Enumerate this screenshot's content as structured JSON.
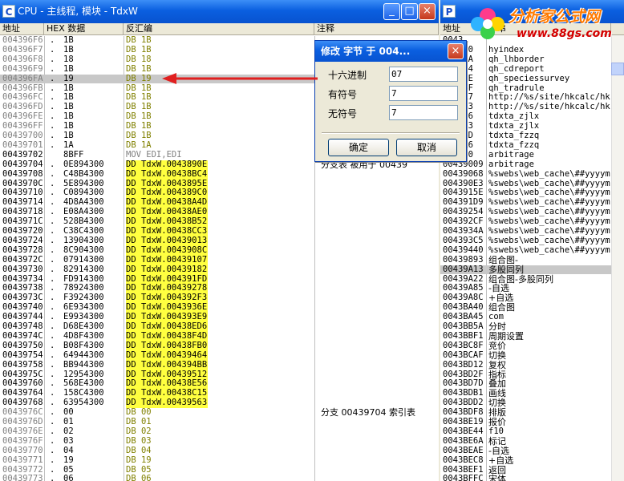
{
  "cpu_window": {
    "icon_letter": "C",
    "title": "CPU - 主线程, 模块 - TdxW",
    "buttons": [
      "_",
      "□",
      "×"
    ],
    "headers": [
      "地址",
      "HEX 数据",
      "反汇编",
      "注释"
    ],
    "rows": [
      {
        "addr": "004396F6",
        "dot": ".",
        "hex": "1B",
        "dis": "DB 1B",
        "style": "olive",
        "cmt": ""
      },
      {
        "addr": "004396F7",
        "dot": ".",
        "hex": "1B",
        "dis": "DB 1B",
        "style": "olive",
        "cmt": ""
      },
      {
        "addr": "004396F8",
        "dot": ".",
        "hex": "18",
        "dis": "DB 18",
        "style": "olive",
        "cmt": ""
      },
      {
        "addr": "004396F9",
        "dot": ".",
        "hex": "1B",
        "dis": "DB 1B",
        "style": "olive",
        "cmt": ""
      },
      {
        "addr": "004396FA",
        "dot": ".",
        "hex": "19",
        "dis": "DB 19",
        "style": "olive",
        "cmt": "",
        "selected": true
      },
      {
        "addr": "004396FB",
        "dot": ".",
        "hex": "1B",
        "dis": "DB 1B",
        "style": "olive",
        "cmt": ""
      },
      {
        "addr": "004396FC",
        "dot": ".",
        "hex": "1B",
        "dis": "DB 1B",
        "style": "olive",
        "cmt": ""
      },
      {
        "addr": "004396FD",
        "dot": ".",
        "hex": "1B",
        "dis": "DB 1B",
        "style": "olive",
        "cmt": ""
      },
      {
        "addr": "004396FE",
        "dot": ".",
        "hex": "1B",
        "dis": "DB 1B",
        "style": "olive",
        "cmt": ""
      },
      {
        "addr": "004396FF",
        "dot": ".",
        "hex": "1B",
        "dis": "DB 1B",
        "style": "olive",
        "cmt": ""
      },
      {
        "addr": "00439700",
        "dot": ".",
        "hex": "1B",
        "dis": "DB 1B",
        "style": "olive",
        "cmt": ""
      },
      {
        "addr": "00439701",
        "dot": ".",
        "hex": "1A",
        "dis": "DB 1A",
        "style": "olive",
        "cmt": ""
      },
      {
        "addr": "00439702",
        "dot": "",
        "hex": "8BFF",
        "dis": "MOV EDI,EDI",
        "style": "mov",
        "cmt": ""
      },
      {
        "addr": "00439704",
        "dot": ".",
        "hex": "0E894300",
        "dis": "DD TdxW.0043890E",
        "style": "dd",
        "cmt": "分支表 被用于 00439"
      },
      {
        "addr": "00439708",
        "dot": ".",
        "hex": "C48B4300",
        "dis": "DD TdxW.00438BC4",
        "style": "dd",
        "cmt": ""
      },
      {
        "addr": "0043970C",
        "dot": ".",
        "hex": "5E894300",
        "dis": "DD TdxW.0043895E",
        "style": "dd",
        "cmt": ""
      },
      {
        "addr": "00439710",
        "dot": ".",
        "hex": "C0894300",
        "dis": "DD TdxW.004389C0",
        "style": "dd",
        "cmt": ""
      },
      {
        "addr": "00439714",
        "dot": ".",
        "hex": "4D8A4300",
        "dis": "DD TdxW.00438A4D",
        "style": "dd",
        "cmt": ""
      },
      {
        "addr": "00439718",
        "dot": ".",
        "hex": "E08A4300",
        "dis": "DD TdxW.00438AE0",
        "style": "dd",
        "cmt": ""
      },
      {
        "addr": "0043971C",
        "dot": ".",
        "hex": "528B4300",
        "dis": "DD TdxW.00438B52",
        "style": "dd",
        "cmt": ""
      },
      {
        "addr": "00439720",
        "dot": ".",
        "hex": "C38C4300",
        "dis": "DD TdxW.00438CC3",
        "style": "dd",
        "cmt": ""
      },
      {
        "addr": "00439724",
        "dot": ".",
        "hex": "13904300",
        "dis": "DD TdxW.00439013",
        "style": "dd",
        "cmt": ""
      },
      {
        "addr": "00439728",
        "dot": ".",
        "hex": "8C904300",
        "dis": "DD TdxW.0043908C",
        "style": "dd",
        "cmt": ""
      },
      {
        "addr": "0043972C",
        "dot": ".",
        "hex": "07914300",
        "dis": "DD TdxW.00439107",
        "style": "dd",
        "cmt": ""
      },
      {
        "addr": "00439730",
        "dot": ".",
        "hex": "82914300",
        "dis": "DD TdxW.00439182",
        "style": "dd",
        "cmt": ""
      },
      {
        "addr": "00439734",
        "dot": ".",
        "hex": "FD914300",
        "dis": "DD TdxW.004391FD",
        "style": "dd",
        "cmt": ""
      },
      {
        "addr": "00439738",
        "dot": ".",
        "hex": "78924300",
        "dis": "DD TdxW.00439278",
        "style": "dd",
        "cmt": ""
      },
      {
        "addr": "0043973C",
        "dot": ".",
        "hex": "F3924300",
        "dis": "DD TdxW.004392F3",
        "style": "dd",
        "cmt": ""
      },
      {
        "addr": "00439740",
        "dot": ".",
        "hex": "6E934300",
        "dis": "DD TdxW.0043936E",
        "style": "dd",
        "cmt": ""
      },
      {
        "addr": "00439744",
        "dot": ".",
        "hex": "E9934300",
        "dis": "DD TdxW.004393E9",
        "style": "dd",
        "cmt": ""
      },
      {
        "addr": "00439748",
        "dot": ".",
        "hex": "D68E4300",
        "dis": "DD TdxW.00438ED6",
        "style": "dd",
        "cmt": ""
      },
      {
        "addr": "0043974C",
        "dot": ".",
        "hex": "4D8F4300",
        "dis": "DD TdxW.00438F4D",
        "style": "dd",
        "cmt": ""
      },
      {
        "addr": "00439750",
        "dot": ".",
        "hex": "B08F4300",
        "dis": "DD TdxW.00438FB0",
        "style": "dd",
        "cmt": ""
      },
      {
        "addr": "00439754",
        "dot": ".",
        "hex": "64944300",
        "dis": "DD TdxW.00439464",
        "style": "dd",
        "cmt": ""
      },
      {
        "addr": "00439758",
        "dot": ".",
        "hex": "BB944300",
        "dis": "DD TdxW.004394BB",
        "style": "dd",
        "cmt": ""
      },
      {
        "addr": "0043975C",
        "dot": ".",
        "hex": "12954300",
        "dis": "DD TdxW.00439512",
        "style": "dd",
        "cmt": ""
      },
      {
        "addr": "00439760",
        "dot": ".",
        "hex": "568E4300",
        "dis": "DD TdxW.00438E56",
        "style": "dd",
        "cmt": ""
      },
      {
        "addr": "00439764",
        "dot": ".",
        "hex": "158C4300",
        "dis": "DD TdxW.00438C15",
        "style": "dd",
        "cmt": ""
      },
      {
        "addr": "00439768",
        "dot": ".",
        "hex": "63954300",
        "dis": "DD TdxW.00439563",
        "style": "dd",
        "cmt": ""
      },
      {
        "addr": "0043976C",
        "dot": ".",
        "hex": "00",
        "dis": "DB 00",
        "style": "olive",
        "cmt": "分支 00439704 索引表"
      },
      {
        "addr": "0043976D",
        "dot": ".",
        "hex": "01",
        "dis": "DB 01",
        "style": "olive",
        "cmt": ""
      },
      {
        "addr": "0043976E",
        "dot": ".",
        "hex": "02",
        "dis": "DB 02",
        "style": "olive",
        "cmt": ""
      },
      {
        "addr": "0043976F",
        "dot": ".",
        "hex": "03",
        "dis": "DB 03",
        "style": "olive",
        "cmt": ""
      },
      {
        "addr": "00439770",
        "dot": ".",
        "hex": "04",
        "dis": "DB 04",
        "style": "olive",
        "cmt": ""
      },
      {
        "addr": "00439771",
        "dot": ".",
        "hex": "19",
        "dis": "DB 19",
        "style": "olive",
        "cmt": ""
      },
      {
        "addr": "00439772",
        "dot": ".",
        "hex": "05",
        "dis": "DB 05",
        "style": "olive",
        "cmt": ""
      },
      {
        "addr": "00439773",
        "dot": ".",
        "hex": "06",
        "dis": "DB 06",
        "style": "olive",
        "cmt": ""
      }
    ]
  },
  "dialog": {
    "title": "修改   字节 于 004...",
    "labels": [
      "十六进制",
      "有符号",
      "无符号"
    ],
    "values": [
      "07",
      "7",
      "7"
    ],
    "ok": "确定",
    "cancel": "取消"
  },
  "right_window": {
    "icon_letter": "P",
    "header_partial": "地址",
    "header_partial2": "字串",
    "rows": [
      {
        "a": "0043…",
        "t": ""
      },
      {
        "a": "00…090",
        "t": "hyindex"
      },
      {
        "a": "00…0BA",
        "t": "qh_lhborder"
      },
      {
        "a": "00…0E4",
        "t": "qh_cdreport"
      },
      {
        "a": "00…20E",
        "t": "qh_speciessurvey"
      },
      {
        "a": "00…24F",
        "t": "qh_tradrule"
      },
      {
        "a": "00…EA7",
        "t": "http://%s/site/hkcalc/hk"
      },
      {
        "a": "00…EB3",
        "t": "http://%s/site/hkcalc/hk"
      },
      {
        "a": "00…ED6",
        "t": "tdxta_zjlx"
      },
      {
        "a": "00…F33",
        "t": "tdxta_zjlx"
      },
      {
        "a": "00…F4D",
        "t": "tdxta_fzzq"
      },
      {
        "a": "00…FA6",
        "t": "tdxta_fzzq"
      },
      {
        "a": "00…FB0",
        "t": "arbitrage"
      },
      {
        "a": "00439009",
        "t": "arbitrage"
      },
      {
        "a": "00439068",
        "t": "%swebs\\web_cache\\##yyyymr"
      },
      {
        "a": "004390E3",
        "t": "%swebs\\web_cache\\##yyyymr"
      },
      {
        "a": "0043915E",
        "t": "%swebs\\web_cache\\##yyyymr"
      },
      {
        "a": "004391D9",
        "t": "%swebs\\web_cache\\##yyyymr"
      },
      {
        "a": "00439254",
        "t": "%swebs\\web_cache\\##yyyymr"
      },
      {
        "a": "004392CF",
        "t": "%swebs\\web_cache\\##yyyymr"
      },
      {
        "a": "0043934A",
        "t": "%swebs\\web_cache\\##yyyymr"
      },
      {
        "a": "004393C5",
        "t": "%swebs\\web_cache\\##yyyymr"
      },
      {
        "a": "00439440",
        "t": "%swebs\\web_cache\\##yyyymr"
      },
      {
        "a": "00439893",
        "t": "组合图-"
      },
      {
        "a": "00439A13",
        "t": "多股同列",
        "selected": true
      },
      {
        "a": "00439A22",
        "t": "组合图-多股同列"
      },
      {
        "a": "00439A85",
        "t": "-自选"
      },
      {
        "a": "00439A8C",
        "t": "+自选"
      },
      {
        "a": "0043BA40",
        "t": "组合图"
      },
      {
        "a": "0043BA45",
        "t": "com"
      },
      {
        "a": "0043BB5A",
        "t": "分时"
      },
      {
        "a": "0043BBF1",
        "t": "周期设置"
      },
      {
        "a": "0043BC8F",
        "t": "竞价"
      },
      {
        "a": "0043BCAF",
        "t": "切换"
      },
      {
        "a": "0043BD12",
        "t": "复权"
      },
      {
        "a": "0043BD2F",
        "t": "指标"
      },
      {
        "a": "0043BD7D",
        "t": "叠加"
      },
      {
        "a": "0043BDB1",
        "t": "画线"
      },
      {
        "a": "0043BDD2",
        "t": "切换"
      },
      {
        "a": "0043BDF8",
        "t": "排版"
      },
      {
        "a": "0043BE19",
        "t": "报价"
      },
      {
        "a": "0043BE44",
        "t": "f10"
      },
      {
        "a": "0043BE6A",
        "t": "标记"
      },
      {
        "a": "0043BEAE",
        "t": "-自选"
      },
      {
        "a": "0043BEC8",
        "t": "+自选"
      },
      {
        "a": "0043BEF1",
        "t": "返回"
      },
      {
        "a": "0043BFFC",
        "t": "宋体"
      }
    ]
  },
  "watermark": {
    "site_name": "分析家公式网",
    "url": "www.88gs.com",
    "color_title": "#ff8a00",
    "color_url": "#d40000"
  },
  "colors": {
    "titlebar": "#0a5fe0",
    "highlight": "#ffff40",
    "arrow": "#e02020",
    "olive": "#808000"
  }
}
